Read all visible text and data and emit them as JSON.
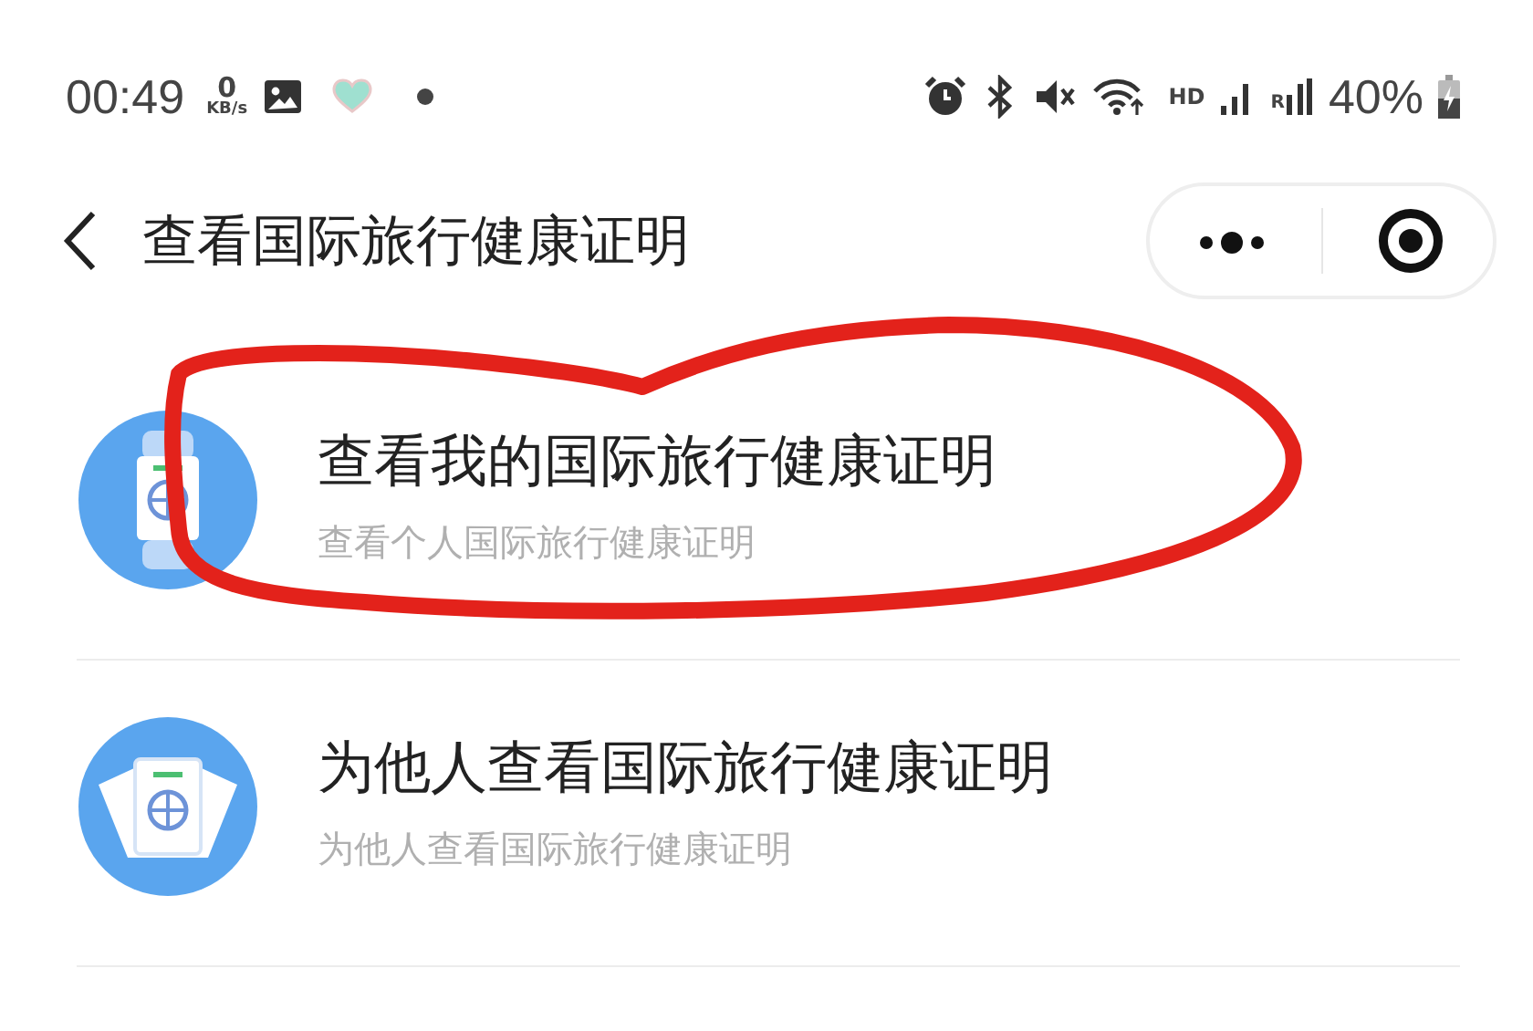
{
  "status_bar": {
    "time": "00:49",
    "net_speed_value": "0",
    "net_speed_unit": "KB/s",
    "network_type": "HD",
    "roaming": "R",
    "battery": "40%"
  },
  "header": {
    "title": "查看国际旅行健康证明"
  },
  "items": [
    {
      "title": "查看我的国际旅行健康证明",
      "subtitle": "查看个人国际旅行健康证明",
      "kind": "self"
    },
    {
      "title": "为他人查看国际旅行健康证明",
      "subtitle": "为他人查看国际旅行健康证明",
      "kind": "others"
    }
  ]
}
